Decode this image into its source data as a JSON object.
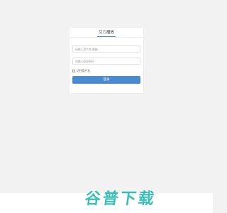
{
  "login": {
    "title": "艾力播放",
    "account_placeholder": "请输入用户名/邮箱",
    "password_placeholder": "请输入登录密码",
    "remember_label": "记住用户名",
    "login_button": "登录"
  },
  "watermark": {
    "text": "谷普下载"
  },
  "colors": {
    "accent": "#4a8ad0",
    "background": "#f2f2f2",
    "watermark": "#18b4ac"
  }
}
